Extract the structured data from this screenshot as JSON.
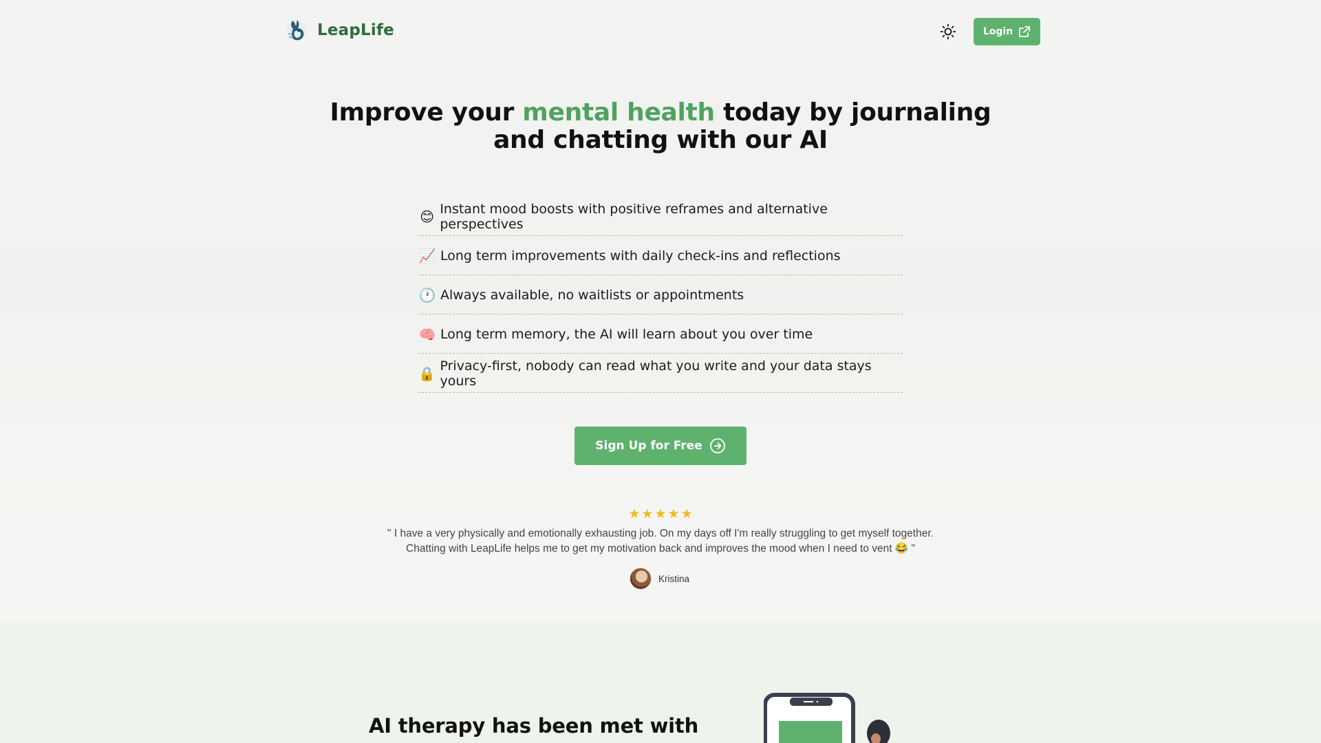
{
  "header": {
    "brand_name": "LeapLife",
    "login_label": "Login"
  },
  "hero": {
    "title_before": "Improve your ",
    "title_accent": "mental health",
    "title_after": " today by journaling and chatting with our AI",
    "features": [
      {
        "emoji": "😊",
        "text": "Instant mood boosts with positive reframes and alternative perspectives"
      },
      {
        "emoji": "📈",
        "text": "Long term improvements with daily check-ins and reflections"
      },
      {
        "emoji": "🕐",
        "text": "Always available, no waitlists or appointments"
      },
      {
        "emoji": "🧠",
        "text": "Long term memory, the AI will learn about you over time"
      },
      {
        "emoji": "🔒",
        "text": "Privacy-first, nobody can read what you write and your data stays yours"
      }
    ],
    "signup_label": "Sign Up for Free"
  },
  "testimonial": {
    "rating": 5,
    "quote_line1": "\" I have a very physically and emotionally exhausting job. On my days off I'm really struggling to get myself together.",
    "quote_line2": "Chatting with LeapLife helps me to get my motivation back and improves the mood when I need to vent 😂 \"",
    "author": "Kristina"
  },
  "lower": {
    "title": "AI therapy has been met with"
  },
  "colors": {
    "accent": "#5fb26e",
    "accent_text": "#4fa35f",
    "brand": "#2e6b3b",
    "star": "#f5b91f"
  }
}
